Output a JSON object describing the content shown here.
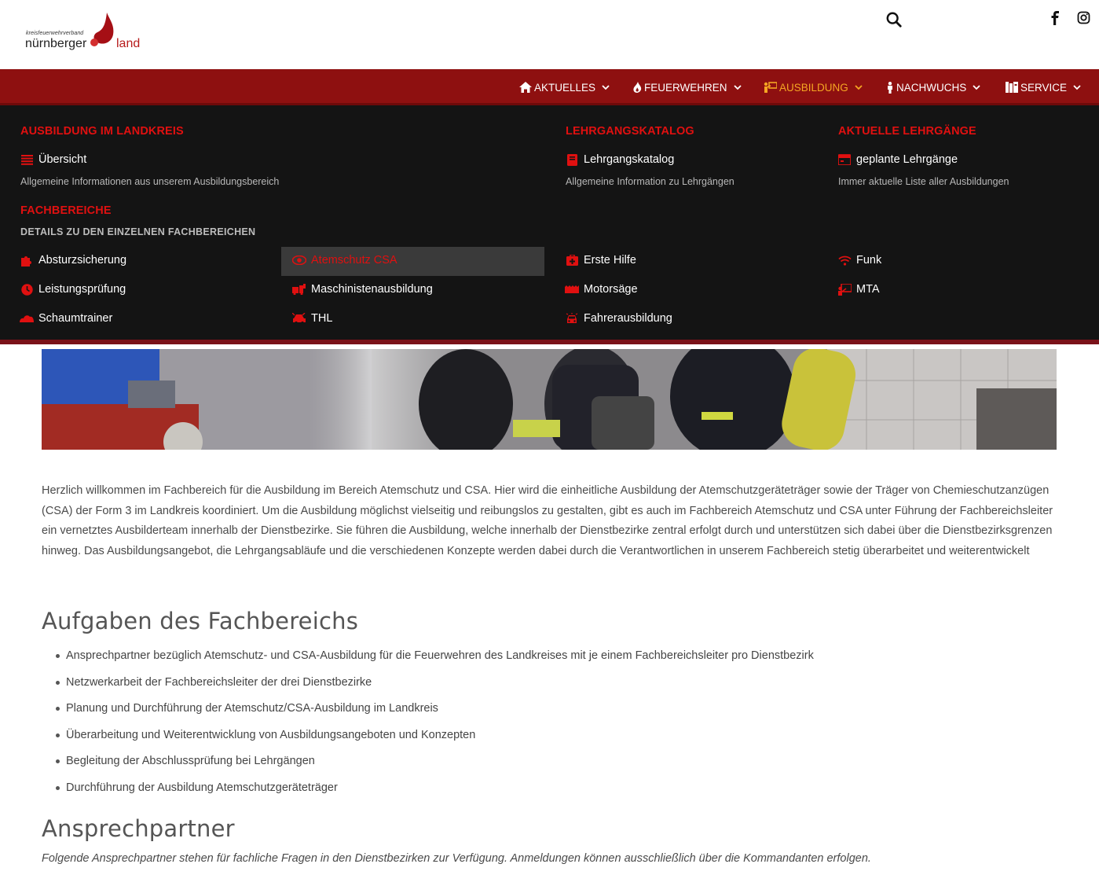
{
  "header": {
    "logo_small": "kreisfeuerwehrverband",
    "logo_main": "nürnberger",
    "logo_land": "land",
    "search_icon": "search-icon",
    "social": [
      "facebook-icon",
      "instagram-icon"
    ]
  },
  "nav": {
    "items": [
      {
        "label": "AKTUELLES",
        "icon": "home-icon"
      },
      {
        "label": "FEUERWEHREN",
        "icon": "flame-icon"
      },
      {
        "label": "AUSBILDUNG",
        "icon": "training-icon"
      },
      {
        "label": "NACHWUCHS",
        "icon": "child-icon"
      },
      {
        "label": "SERVICE",
        "icon": "service-icon"
      }
    ],
    "active": "AUSBILDUNG",
    "active_color": "#f5a623",
    "bar_color": "#8e1010"
  },
  "mega": {
    "col1": {
      "heading": "AUSBILDUNG IM LANDKREIS",
      "link": "Übersicht",
      "desc": "Allgemeine Informationen aus unserem Ausbildungsbereich"
    },
    "col2": {
      "heading": "LEHRGANGSKATALOG",
      "link": "Lehrgangskatalog",
      "desc": "Allgemeine Information zu Lehrgängen"
    },
    "col3": {
      "heading": "AKTUELLE LEHRGÄNGE",
      "link": "geplante Lehrgänge",
      "desc": "Immer aktuelle Liste aller Ausbildungen"
    },
    "fach": {
      "heading": "FACHBEREICHE",
      "sub": "DETAILS ZU DEN EINZELNEN FACHBEREICHEN",
      "items": [
        "Absturzsicherung",
        "Atemschutz CSA",
        "Erste Hilfe",
        "Funk",
        "Leistungsprüfung",
        "Maschinistenausbildung",
        "Motorsäge",
        "MTA",
        "Schaumtrainer",
        "THL",
        "Fahrerausbildung"
      ],
      "selected": "Atemschutz CSA"
    },
    "accent_color": "#e01010"
  },
  "content": {
    "intro": "Herzlich willkommen im Fachbereich für die Ausbildung im Bereich Atemschutz und CSA. Hier wird die einheitliche Ausbildung der Atemschutzgeräteträger sowie der Träger von Chemieschutzanzügen (CSA) der Form 3 im Landkreis koordiniert. Um die Ausbildung möglichst vielseitig und reibungslos zu gestalten, gibt es auch im Fachbereich Atemschutz und CSA unter Führung der Fachbereichsleiter ein vernetztes Ausbilderteam innerhalb der Dienstbezirke. Sie führen die Ausbildung, welche innerhalb der Dienstbezirke zentral erfolgt durch und unterstützen sich dabei über die Dienstbezirksgrenzen hinweg. Das Ausbildungsangebot, die Lehrgangsabläufe und die verschiedenen Konzepte werden dabei durch die Verantwortlichen in unserem Fachbereich stetig überarbeitet und weiterentwickelt",
    "tasks_heading": "Aufgaben des Fachbereichs",
    "tasks": [
      "Ansprechpartner bezüglich Atemschutz- und CSA-Ausbildung für die Feuerwehren des Landkreises mit je einem Fachbereichsleiter pro Dienstbezirk",
      "Netzwerkarbeit der Fachbereichsleiter der drei Dienstbezirke",
      "Planung und Durchführung der Atemschutz/CSA-Ausbildung im Landkreis",
      "Überarbeitung und Weiterentwicklung von Ausbildungsangeboten und Konzepten",
      "Begleitung der Abschlussprüfung bei Lehrgängen",
      "Durchführung der Ausbildung Atemschutzgeräteträger"
    ],
    "contact_heading": "Ansprechpartner",
    "contact_note": "Folgende Ansprechpartner stehen für fachliche Fragen in den Dienstbezirken zur Verfügung. Anmeldungen können ausschließlich über die Kommandanten erfolgen."
  }
}
